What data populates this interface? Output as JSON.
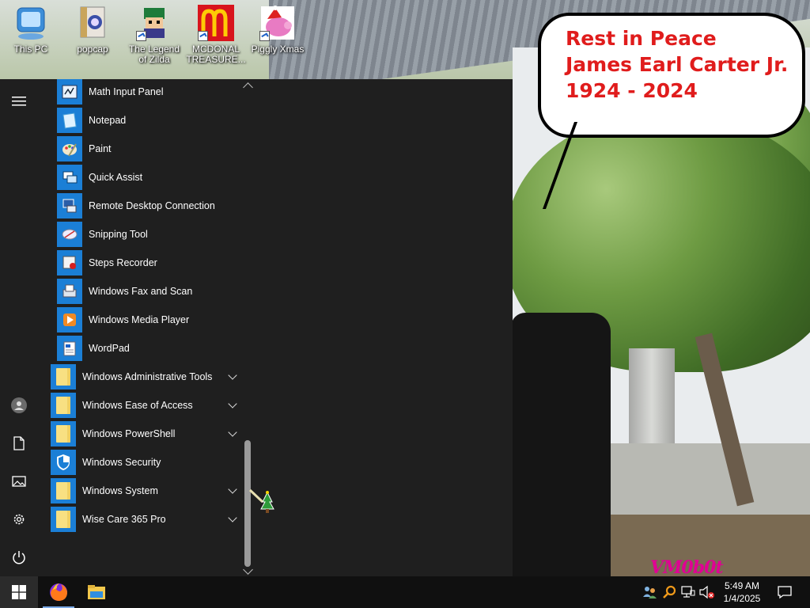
{
  "desktop": {
    "icons": [
      {
        "label": "This PC",
        "icon": "computer-icon"
      },
      {
        "label": "popcap",
        "icon": "popcap-icon"
      },
      {
        "label": "The Legend of Zilda",
        "icon": "legend-game-icon"
      },
      {
        "label": "MCDONAL TREASURE...",
        "icon": "mcdonalds-icon"
      },
      {
        "label": "Piggly Xmas",
        "icon": "piggly-icon"
      }
    ],
    "wallpaper_caption": [
      "Rest in Peace",
      "James Earl Carter Jr.",
      "1924 - 2024"
    ],
    "watermark": "VM0b0t"
  },
  "start_menu": {
    "apps": [
      {
        "label": "Math Input Panel",
        "icon": "math-input-icon",
        "type": "app"
      },
      {
        "label": "Notepad",
        "icon": "notepad-icon",
        "type": "app"
      },
      {
        "label": "Paint",
        "icon": "paint-icon",
        "type": "app"
      },
      {
        "label": "Quick Assist",
        "icon": "quick-assist-icon",
        "type": "app"
      },
      {
        "label": "Remote Desktop Connection",
        "icon": "remote-desktop-icon",
        "type": "app"
      },
      {
        "label": "Snipping Tool",
        "icon": "snipping-tool-icon",
        "type": "app"
      },
      {
        "label": "Steps Recorder",
        "icon": "steps-recorder-icon",
        "type": "app"
      },
      {
        "label": "Windows Fax and Scan",
        "icon": "fax-scan-icon",
        "type": "app"
      },
      {
        "label": "Windows Media Player",
        "icon": "media-player-icon",
        "type": "app"
      },
      {
        "label": "WordPad",
        "icon": "wordpad-icon",
        "type": "app"
      },
      {
        "label": "Windows Administrative Tools",
        "icon": "folder-icon",
        "type": "folder"
      },
      {
        "label": "Windows Ease of Access",
        "icon": "folder-icon",
        "type": "folder"
      },
      {
        "label": "Windows PowerShell",
        "icon": "folder-icon",
        "type": "folder"
      },
      {
        "label": "Windows Security",
        "icon": "shield-icon",
        "type": "app-top"
      },
      {
        "label": "Windows System",
        "icon": "folder-icon",
        "type": "folder"
      },
      {
        "label": "Wise Care 365 Pro",
        "icon": "folder-icon",
        "type": "folder"
      }
    ],
    "rail": [
      "hamburger-icon",
      "user-icon",
      "documents-icon",
      "pictures-icon",
      "settings-icon",
      "power-icon"
    ]
  },
  "taskbar": {
    "pinned": [
      "firefox-icon",
      "file-explorer-icon"
    ],
    "tray": [
      "people-icon",
      "search-tray-icon",
      "network-icon",
      "volume-muted-icon"
    ],
    "time": "5:49 AM",
    "date": "1/4/2025"
  },
  "colors": {
    "accent": "#1b7fd6",
    "menu_bg": "#1f1f1f",
    "taskbar_bg": "#101010"
  }
}
